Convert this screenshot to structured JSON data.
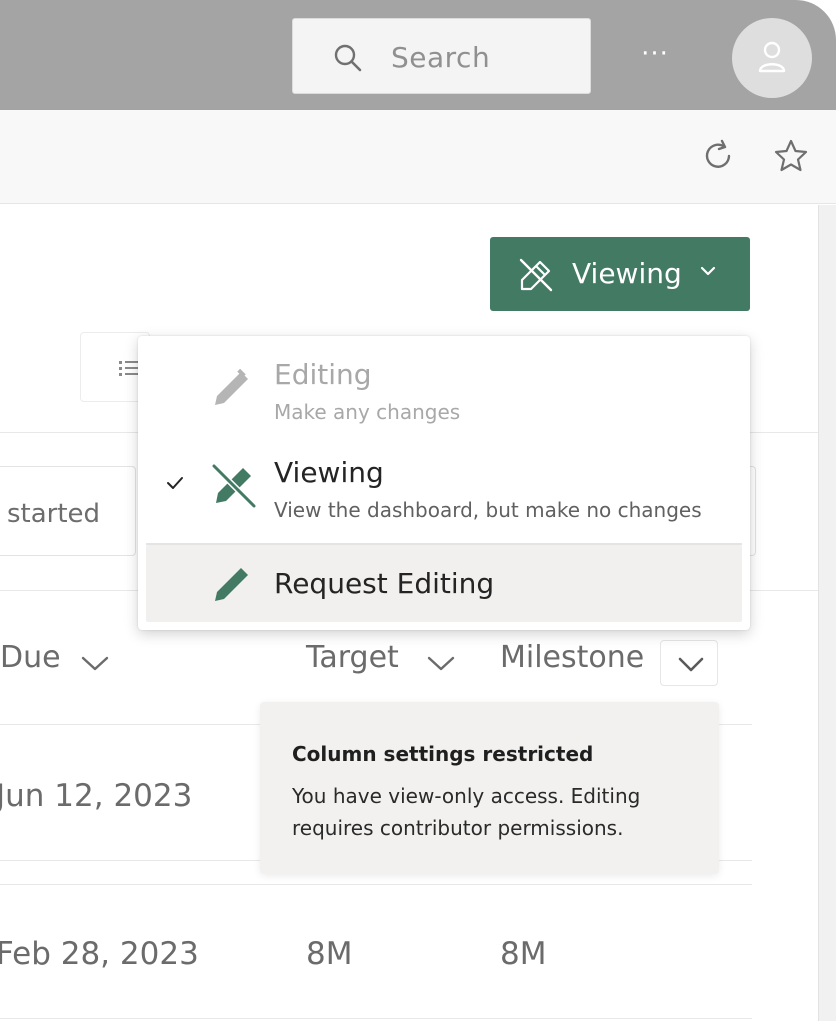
{
  "titlebar": {
    "search_placeholder": "Search",
    "more_label": "···"
  },
  "actions": {
    "mode_button_label": "Viewing"
  },
  "filter": {
    "status_text": "started"
  },
  "mode_menu": {
    "items": [
      {
        "title": "Editing",
        "subtitle": "Make any changes",
        "state": "disabled",
        "icon": "pencil-icon"
      },
      {
        "title": "Viewing",
        "subtitle": "View the dashboard, but make no changes",
        "state": "selected",
        "icon": "pencil-off-icon"
      },
      {
        "title": "Request Editing",
        "subtitle": "",
        "state": "highlighted",
        "icon": "pencil-icon"
      }
    ]
  },
  "table": {
    "columns": [
      "Due",
      "Target",
      "Milestone"
    ],
    "rows": [
      {
        "due": "Jun 12, 2023",
        "target": "",
        "milestone": ""
      },
      {
        "due": "Feb 28, 2023",
        "target": "8M",
        "milestone": "8M"
      }
    ]
  },
  "tooltip": {
    "title": "Column settings restricted",
    "body": "You have view-only access. Editing requires contributor permissions."
  },
  "colors": {
    "accent": "#427a64",
    "titlebar": "#a4a4a4",
    "menu_highlight": "#f1f0ee"
  }
}
